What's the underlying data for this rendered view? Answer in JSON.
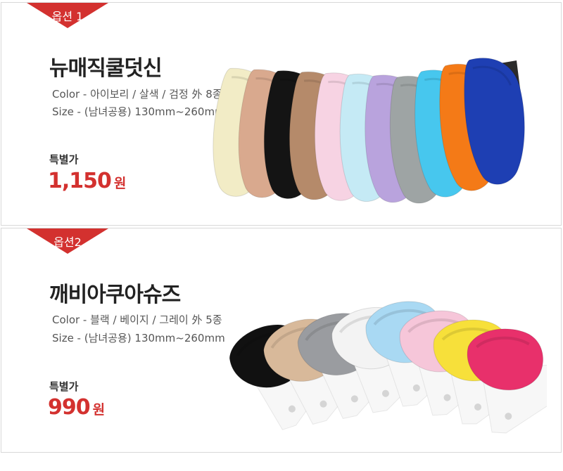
{
  "options": [
    {
      "tag": "옵션 1",
      "title": "뉴매직쿨덧신",
      "color_line": "Color - 아이보리 / 살색 / 검정 外 8종",
      "size_line": "Size - (남녀공용) 130mm~260mm",
      "price_label": "특별가",
      "price": "1,150",
      "price_unit": "원",
      "sock_colors": [
        "#f2ecc6",
        "#d9a98e",
        "#141414",
        "#b58a6a",
        "#f7d3e3",
        "#c5eaf5",
        "#b9a3dd",
        "#9ea4a4",
        "#47c7ee",
        "#f47a17",
        "#1e3fb3"
      ]
    },
    {
      "tag": "옵션2",
      "title": "깨비아쿠아슈즈",
      "color_line": "Color - 블랙 / 베이지 / 그레이 外 5종",
      "size_line": "Size - (남녀공용) 130mm~260mm",
      "price_label": "특별가",
      "price": "990",
      "price_unit": "원",
      "sock_colors": [
        "#111111",
        "#d8b99a",
        "#9a9ca0",
        "#f3f3f3",
        "#a9d9f3",
        "#f6c6d9",
        "#f7e03a",
        "#e8306b"
      ]
    }
  ],
  "colors": {
    "accent": "#d3312f",
    "border": "#d9d9d9"
  }
}
